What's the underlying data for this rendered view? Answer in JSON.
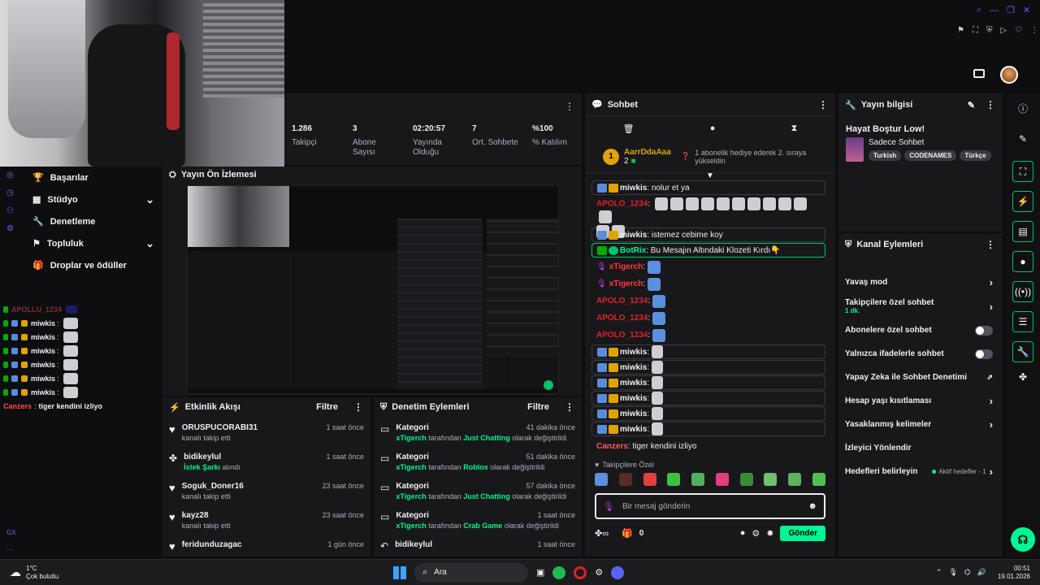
{
  "stats": [
    {
      "value": "1.286",
      "label": "Takipçi"
    },
    {
      "value": "3",
      "label": "Abone Sayısı"
    },
    {
      "value": "02:20:57",
      "label": "Yayında Olduğu"
    },
    {
      "value": "7",
      "label": "Ort. Sohbete"
    },
    {
      "value": "%100",
      "label": "% Katılım"
    }
  ],
  "nav": {
    "items": [
      {
        "label": "Başarılar"
      },
      {
        "label": "Stüdyo"
      },
      {
        "label": "Denetleme"
      },
      {
        "label": "Topluluk"
      },
      {
        "label": "Droplar ve ödüller"
      }
    ]
  },
  "preview": {
    "title": "Yayın Ön İzlemesi"
  },
  "mini_chat": [
    {
      "name": "APOLLU_1234",
      "text": ""
    },
    {
      "name": "miwkis",
      "text": ""
    },
    {
      "name": "miwkis",
      "text": ""
    },
    {
      "name": "miwkis",
      "text": ""
    },
    {
      "name": "miwkis",
      "text": ""
    },
    {
      "name": "miwkis",
      "text": ""
    },
    {
      "name": "miwkis",
      "text": ""
    },
    {
      "name": "Canzers",
      "text": "tiger kendini izliyo"
    }
  ],
  "activity": {
    "title": "Etkinlik Akışı",
    "filter": "Filtre",
    "items": [
      {
        "name": "ORUSPUCORABI31",
        "sub": "kanalı takip etti",
        "time": "1 saat önce"
      },
      {
        "name": "bidikeylul",
        "sub_a": "İstek Şarkı",
        "sub_b": "alındı",
        "time": "1 saat önce"
      },
      {
        "name": "Soguk_Doner16",
        "sub": "kanalı takip etti",
        "time": "23 saat önce"
      },
      {
        "name": "kayz28",
        "sub": "kanalı takip etti",
        "time": "23 saat önce"
      },
      {
        "name": "feridunduzagac",
        "sub": "",
        "time": "1 gün önce"
      }
    ]
  },
  "modlog": {
    "title": "Denetim Eylemleri",
    "filter": "Filtre",
    "items": [
      {
        "title": "Kategori",
        "user": "xTigerch",
        "mid": "tarafından",
        "cat": "Just Chatting",
        "end": "olarak değiştirildi",
        "time": "41 dakika önce"
      },
      {
        "title": "Kategori",
        "user": "xTigerch",
        "mid": "tarafından",
        "cat": "Roblox",
        "end": "olarak değiştirildi",
        "time": "51 dakika önce"
      },
      {
        "title": "Kategori",
        "user": "xTigerch",
        "mid": "tarafından",
        "cat": "Just Chatting",
        "end": "olarak değiştirildi",
        "time": "57 dakika önce"
      },
      {
        "title": "Kategori",
        "user": "xTigerch",
        "mid": "tarafından",
        "cat": "Crab Game",
        "end": "olarak değiştirildi",
        "time": "1 saat önce"
      },
      {
        "title": "bidikeylul",
        "user": "",
        "mid": "",
        "cat": "",
        "end": "",
        "time": "1 saat önce"
      }
    ]
  },
  "chat": {
    "title": "Sohbet",
    "pinned": {
      "rank": "1",
      "name": "AarrDdaAaa",
      "count": "2",
      "text": "1 abonelik hediye ederek 2. sıraya yükseldin"
    },
    "lines": [
      {
        "name": "miwkis",
        "color": "#efeff1",
        "text": "nolur et ya",
        "box": true
      },
      {
        "name": "APOLO_1234",
        "color": "#e0202c",
        "text": "",
        "box": false
      },
      {
        "name": "miwkis",
        "color": "#efeff1",
        "text": "istemez cebime koy",
        "box": true
      },
      {
        "name": "BotRix",
        "color": "#00f593",
        "text": "Bu Mesajın Altındaki Klozeti Kırdı👇",
        "box": true
      },
      {
        "name": "xTigerch",
        "color": "#ff3b3b",
        "text": "",
        "box": false
      },
      {
        "name": "xTigerch",
        "color": "#ff3b3b",
        "text": "",
        "box": false
      },
      {
        "name": "APOLO_1234",
        "color": "#e0202c",
        "text": "",
        "box": false
      },
      {
        "name": "APOLO_1234",
        "color": "#e0202c",
        "text": "",
        "box": false
      },
      {
        "name": "APOLO_1234",
        "color": "#e0202c",
        "text": "",
        "box": false
      },
      {
        "name": "miwkis",
        "color": "#efeff1",
        "text": "",
        "box": true
      },
      {
        "name": "miwkis",
        "color": "#efeff1",
        "text": "",
        "box": true
      },
      {
        "name": "miwkis",
        "color": "#efeff1",
        "text": "",
        "box": true
      },
      {
        "name": "miwkis",
        "color": "#efeff1",
        "text": "",
        "box": true
      },
      {
        "name": "miwkis",
        "color": "#efeff1",
        "text": "",
        "box": true
      },
      {
        "name": "miwkis",
        "color": "#efeff1",
        "text": "",
        "box": true
      },
      {
        "name": "Canzers",
        "color": "#ff5a5a",
        "text": "tiger kendini izliyo",
        "box": false
      }
    ],
    "followers_only": "Takipçilere Özel",
    "placeholder": "Bir mesaj gönderin",
    "points": "0",
    "send": "Gönder"
  },
  "stream_info": {
    "header": "Yayın bilgisi",
    "title": "Hayat Boştur Low!",
    "category": "Sadece Sohbet",
    "tags": [
      "Turkish",
      "CODENAMES",
      "Türkçe"
    ]
  },
  "channel_actions": {
    "header": "Kanal Eylemleri",
    "items": [
      {
        "label": "Yavaş mod",
        "kind": "chev"
      },
      {
        "label": "Takipçilere özel sohbet",
        "sub": "1 dk.",
        "kind": "chev"
      },
      {
        "label": "Abonelere özel sohbet",
        "kind": "toggle"
      },
      {
        "label": "Yalnızca ifadelerle sohbet",
        "kind": "toggle"
      },
      {
        "label": "Yapay Zeka ile Sohbet Denetimi",
        "kind": "ext"
      },
      {
        "label": "Hesap yaşı kısıtlaması",
        "kind": "chev"
      },
      {
        "label": "Yasaklanmış kelimeler",
        "kind": "chev"
      },
      {
        "label": "İzleyici Yönlendir",
        "kind": "none"
      },
      {
        "label": "Hedefleri belirleyin",
        "extra": "Aktif hedefler - 1",
        "kind": "chev"
      }
    ]
  },
  "taskbar": {
    "temp": "1°C",
    "weather": "Çok bulutlu",
    "search": "Ara",
    "time": "00:51",
    "date": "19.01.2026"
  },
  "colors": {
    "accent": "#00f593",
    "bg": "#0e0e10",
    "panel": "#18181b"
  }
}
